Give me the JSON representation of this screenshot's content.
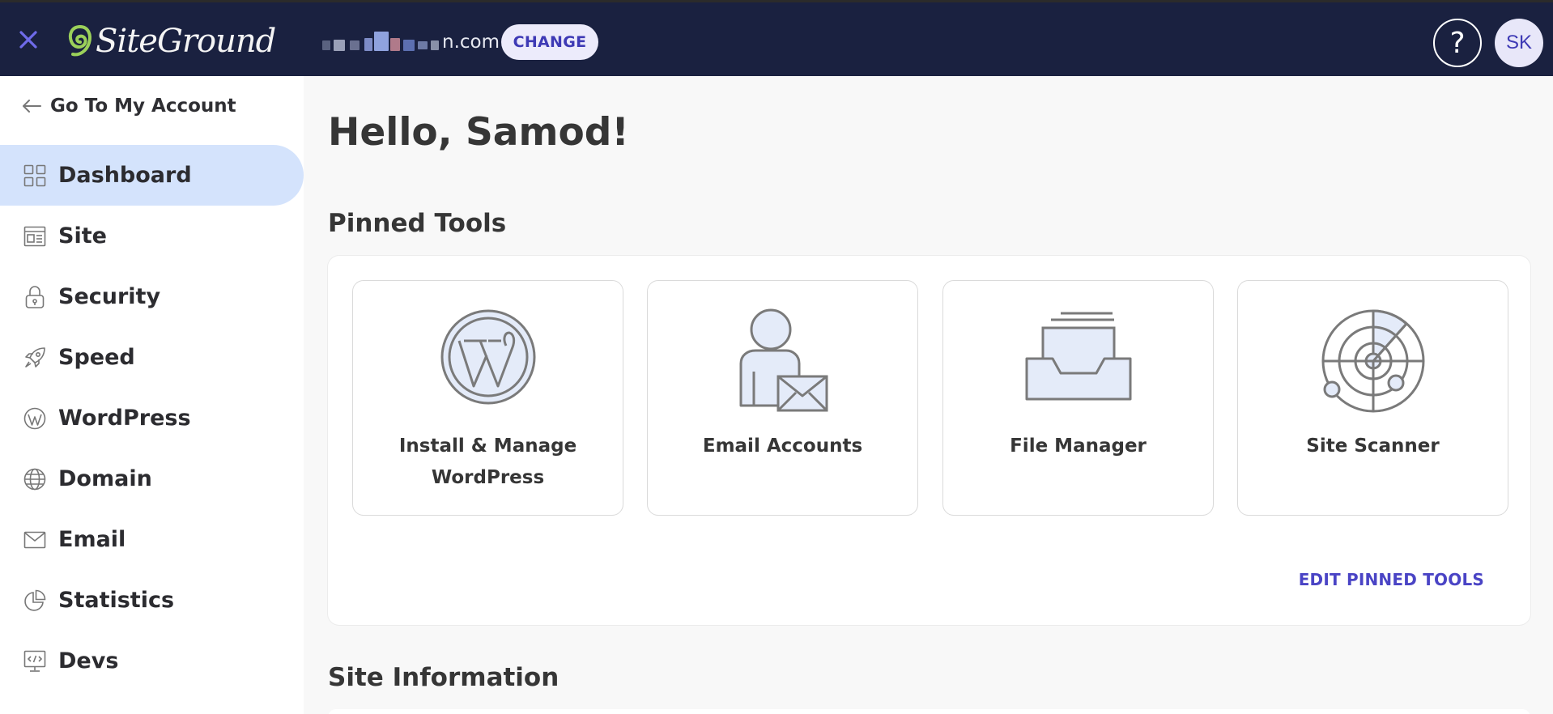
{
  "colors": {
    "topbar": "#1a2140",
    "accent": "#4a44c5",
    "active_nav": "#d4e3fc",
    "logo_green": "#9bd05a"
  },
  "header": {
    "close_icon": "close-icon",
    "logo_text": "SiteGround",
    "domain_suffix": "n.com",
    "change_label": "CHANGE",
    "help_label": "?",
    "avatar_initials": "SK"
  },
  "sidebar": {
    "back_label": "Go To My Account",
    "items": [
      {
        "label": "Dashboard",
        "icon": "grid-icon",
        "active": true
      },
      {
        "label": "Site",
        "icon": "site-icon"
      },
      {
        "label": "Security",
        "icon": "lock-icon"
      },
      {
        "label": "Speed",
        "icon": "rocket-icon"
      },
      {
        "label": "WordPress",
        "icon": "wordpress-icon"
      },
      {
        "label": "Domain",
        "icon": "globe-icon"
      },
      {
        "label": "Email",
        "icon": "envelope-icon"
      },
      {
        "label": "Statistics",
        "icon": "pie-chart-icon"
      },
      {
        "label": "Devs",
        "icon": "code-icon"
      }
    ]
  },
  "main": {
    "greeting": "Hello, Samod!",
    "pinned_title": "Pinned Tools",
    "tools": [
      {
        "label_line1": "Install & Manage",
        "label_line2": "WordPress",
        "icon": "wordpress-icon"
      },
      {
        "label_line1": "Email Accounts",
        "icon": "email-accounts-icon"
      },
      {
        "label_line1": "File Manager",
        "icon": "file-tray-icon"
      },
      {
        "label_line1": "Site Scanner",
        "icon": "radar-icon"
      }
    ],
    "edit_pinned_label": "EDIT PINNED TOOLS",
    "site_info_title": "Site Information"
  }
}
